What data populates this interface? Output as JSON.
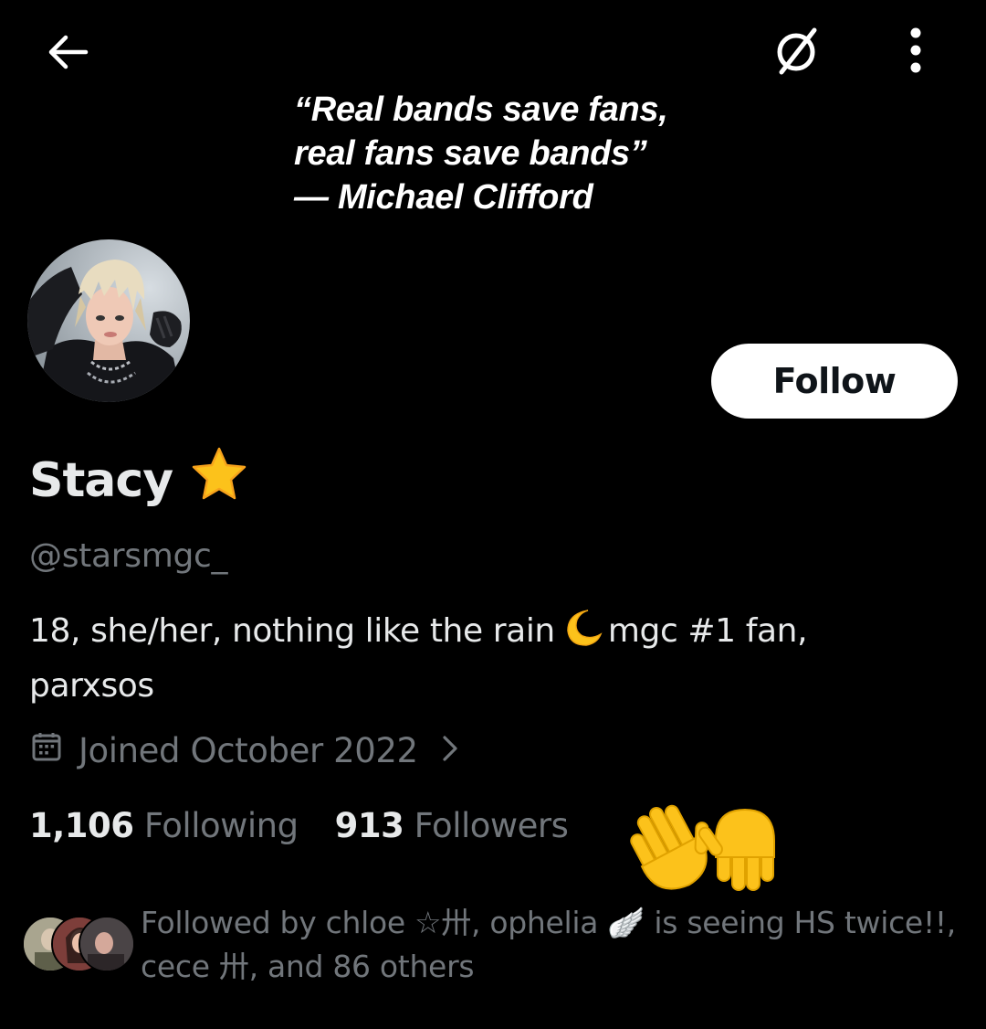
{
  "banner": {
    "quote_line1": "“Real bands save fans,",
    "quote_line2": "real fans save bands”",
    "quote_line3": "— Michael Clifford"
  },
  "profile": {
    "display_name": "Stacy",
    "name_emoji": "star",
    "handle": "@starsmgc_",
    "bio_part1": "18, she/her, nothing like the rain",
    "bio_part2": "mgc #1 fan,",
    "bio_line2": "parxsos",
    "joined": "Joined October 2022"
  },
  "actions": {
    "follow_label": "Follow"
  },
  "stats": {
    "following_count": "1,106",
    "following_label": "Following",
    "followers_count": "913",
    "followers_label": "Followers"
  },
  "followed_by": {
    "line1": "Followed by chloe ☆卅, ophelia 🪽 is seeing HS twice!!,",
    "line2": "cece 卅, and 86 others"
  },
  "icons": {
    "back": "arrow-left-icon",
    "translate_off": "no-translation-icon",
    "more": "vertical-ellipsis-icon",
    "calendar": "calendar-icon",
    "chevron": "chevron-right-icon",
    "moon": "crescent-moon-emoji",
    "hands": "palms-up-emoji"
  },
  "colors": {
    "background": "#000000",
    "primary_text": "#e7e9ea",
    "secondary_text": "#71767b",
    "button_bg": "#ffffff",
    "button_text": "#0f1419",
    "emoji_yellow": "#fcc21b"
  }
}
